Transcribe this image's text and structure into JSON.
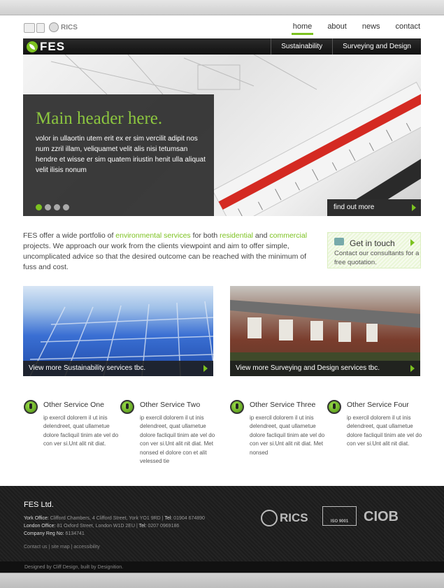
{
  "topnav": {
    "items": [
      "home",
      "about",
      "news",
      "contact"
    ],
    "active": "home",
    "rics": "RICS"
  },
  "brand": {
    "name": "FES",
    "accent": "#7cc220"
  },
  "mainnav": {
    "items": [
      "Sustainability",
      "Surveying and Design"
    ]
  },
  "hero": {
    "title": "Main header here.",
    "body": "volor in ullaortin utem erit ex er sim vercilit adipit nos num zzril illam, veliquamet velit alis nisi tetumsan hendre et wisse er sim quatem iriustin henit ulla aliquat velit ilisis nonum",
    "slides": 4,
    "active_slide": 1,
    "find_more": "find out more"
  },
  "intro": {
    "t1": "FES offer a wide portfolio of ",
    "l1": "environmental services",
    "t2": " for both ",
    "l2": "residential",
    "t3": " and ",
    "l3": "commercial",
    "t4": " projects. We approach our work from the clients viewpoint and aim to offer simple, uncomplicated advice so that the desired outcome can be reached with the minimum of fuss and cost."
  },
  "get_in_touch": {
    "title": "Get in touch",
    "text": "Contact our consultants for a free quotation."
  },
  "tiles": [
    {
      "caption": "View more Sustainability services tbc."
    },
    {
      "caption": "View more Surveying and Design services tbc."
    }
  ],
  "services": [
    {
      "title": "Other Service One",
      "text": "ip exercil dolorem il ut inis delendreet, quat ullametue dolore facliquil tinim ate vel do con ver si.Unt alit nit diat."
    },
    {
      "title": "Other Service Two",
      "text": "ip exercil dolorem il ut inis delendreet, quat ullametue dolore facliquil tinim ate vel do con ver si.Unt alit nit diat. Met nonsed el dolore con et alit velessed tie"
    },
    {
      "title": "Other Service Three",
      "text": "ip exercil dolorem il ut inis delendreet, quat ullametue dolore facliquil tinim ate vel do con ver si.Unt alit nit diat. Met nonsed"
    },
    {
      "title": "Other Service Four",
      "text": "ip exercil dolorem il ut inis delendreet, quat ullametue dolore facliquil tinim ate vel do con ver si.Unt alit nit diat."
    }
  ],
  "footer": {
    "company": "FES Ltd.",
    "york_label": "York Office:",
    "york": "Clifford Chambers, 4 Clifford Street, York YO1 9RD",
    "york_tel_label": "Tel:",
    "york_tel": "01904 674890",
    "london_label": "London Office:",
    "london": "81 Oxford Street, London W1D 2EU",
    "london_tel_label": "Tel:",
    "london_tel": "0207 0969186",
    "reg_label": "Company Reg No:",
    "reg": "6134741",
    "links": [
      "Contact us",
      "site map",
      "accessibility"
    ],
    "logos": {
      "rics": "RICS",
      "ciob": "CIOB",
      "iso": "ISO 9001"
    },
    "credit": "Designed by Cliff Design, built by Designition."
  }
}
